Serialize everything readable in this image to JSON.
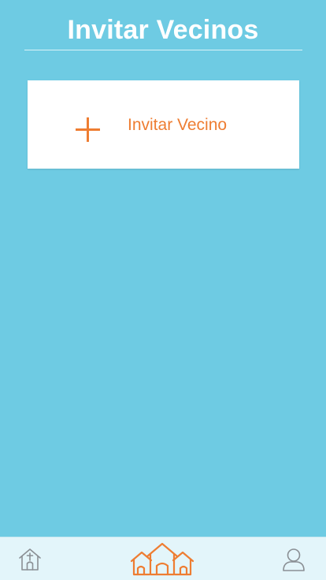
{
  "header": {
    "title": "Invitar Vecinos"
  },
  "invite_card": {
    "icon": "plus-icon",
    "label": "Invitar Vecino"
  },
  "tab_bar": {
    "items": [
      {
        "icon": "church-home-icon",
        "active": false
      },
      {
        "icon": "neighbors-houses-icon",
        "active": true
      },
      {
        "icon": "user-profile-icon",
        "active": false
      }
    ]
  },
  "colors": {
    "background": "#6ecbe3",
    "accent": "#ee7d32",
    "card": "#ffffff",
    "tab_bar": "#e3f5fa",
    "inactive_icon": "#8a8f94"
  }
}
